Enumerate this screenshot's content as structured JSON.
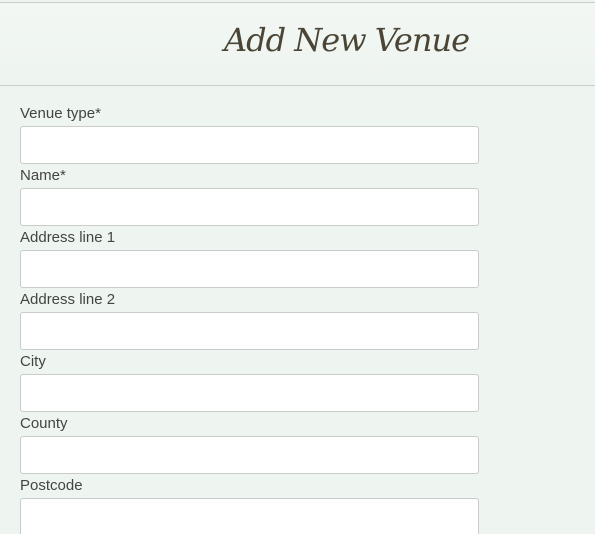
{
  "header": {
    "title": "Add New Venue"
  },
  "form": {
    "fields": [
      {
        "label": "Venue type*",
        "value": "",
        "placeholder": ""
      },
      {
        "label": "Name*",
        "value": "",
        "placeholder": ""
      },
      {
        "label": "Address line 1",
        "value": "",
        "placeholder": ""
      },
      {
        "label": "Address line 2",
        "value": "",
        "placeholder": ""
      },
      {
        "label": "City",
        "value": "",
        "placeholder": ""
      },
      {
        "label": "County",
        "value": "",
        "placeholder": ""
      },
      {
        "label": "Postcode",
        "value": "",
        "placeholder": ""
      }
    ]
  }
}
